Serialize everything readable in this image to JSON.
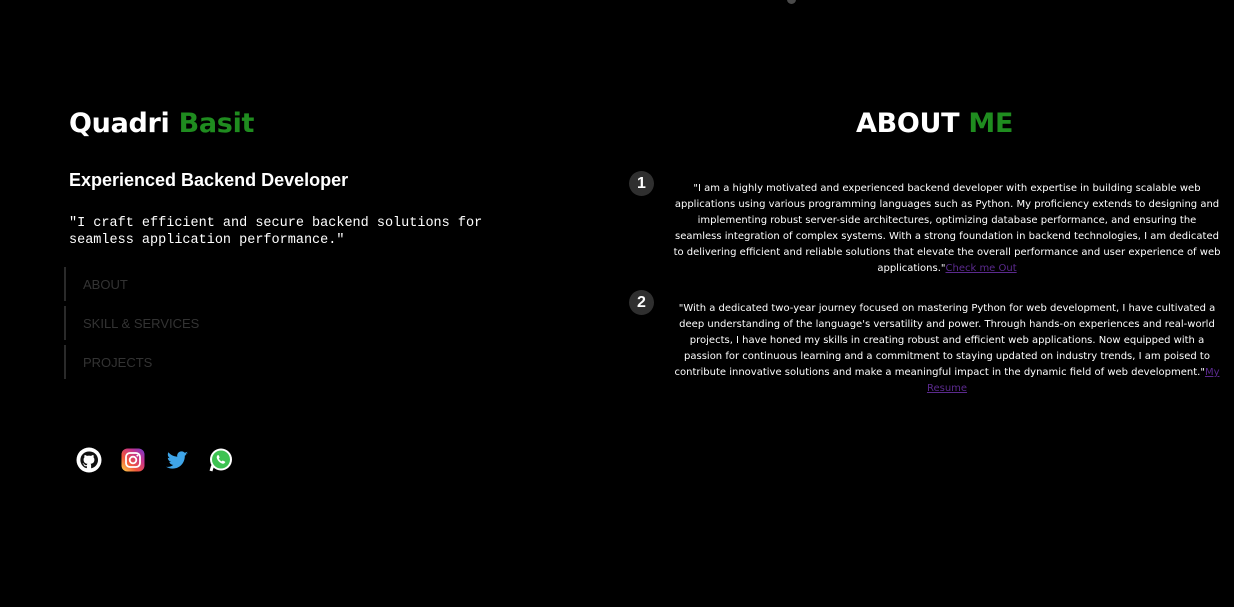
{
  "profile": {
    "first_name": "Quadri",
    "last_name": "Basit",
    "title": "Experienced Backend Developer",
    "tagline": "\"I craft efficient and secure backend solutions for seamless application performance.\""
  },
  "nav": {
    "items": [
      {
        "label": "ABOUT"
      },
      {
        "label": "SKILL & SERVICES"
      },
      {
        "label": "PROJECTS"
      }
    ]
  },
  "socials": [
    {
      "icon": "github-icon"
    },
    {
      "icon": "instagram-icon"
    },
    {
      "icon": "twitter-icon"
    },
    {
      "icon": "whatsapp-icon"
    }
  ],
  "about": {
    "heading_part1": "ABOUT",
    "heading_part2": "ME",
    "items": [
      {
        "number": "1",
        "text": "\"I am a highly motivated and experienced backend developer with expertise in building scalable web applications using various programming languages such as Python. My proficiency extends to designing and implementing robust server-side architectures, optimizing database performance, and ensuring the seamless integration of complex systems. With a strong foundation in backend technologies, I am dedicated to delivering efficient and reliable solutions that elevate the overall performance and user experience of web applications.\"",
        "link": "Check me Out"
      },
      {
        "number": "2",
        "text": "\"With a dedicated two-year journey focused on mastering Python for web development, I have cultivated a deep understanding of the language's versatility and power. Through hands-on experiences and real-world projects, I have honed my skills in creating robust and efficient web applications. Now equipped with a passion for continuous learning and a commitment to staying updated on industry trends, I am poised to contribute innovative solutions and make a meaningful impact in the dynamic field of web development.\"",
        "link": "My Resume"
      }
    ]
  },
  "colors": {
    "accent": "#1f8c1f",
    "background": "#000000",
    "link": "#5b2a8e",
    "nav_text": "#333333"
  }
}
